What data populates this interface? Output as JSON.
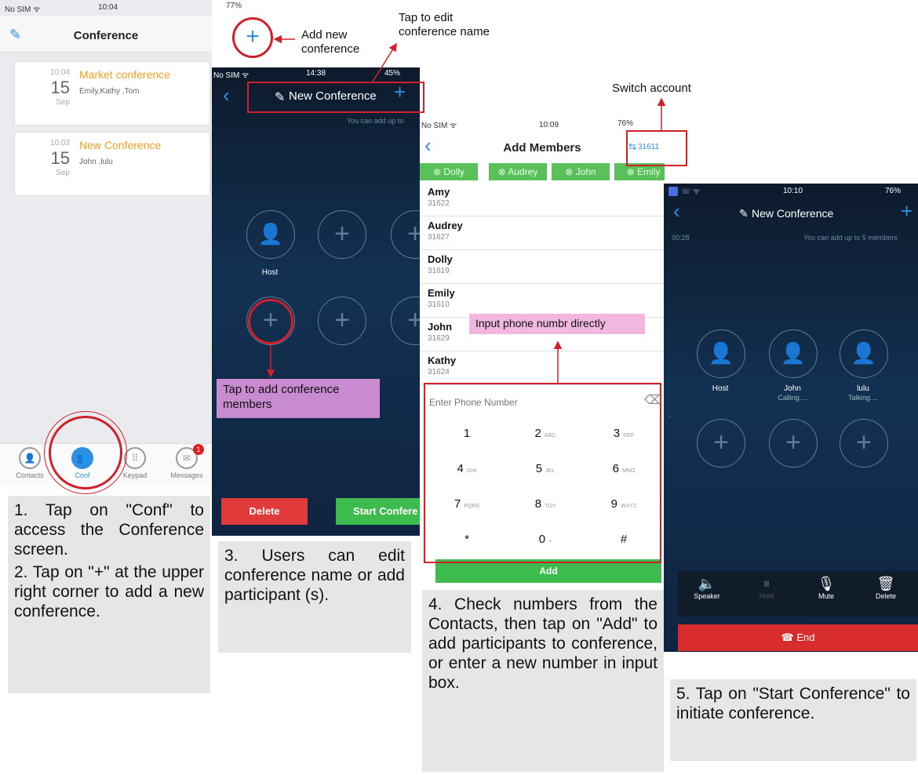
{
  "screen1": {
    "status": {
      "carrier": "No SIM ᯤ",
      "time": "10:04",
      "battery": "77%"
    },
    "title": "Conference",
    "conferences": [
      {
        "time": "10:04",
        "day": "15",
        "month": "Sep",
        "name": "Market conference",
        "participants": "Emily,Kathy ,Tom"
      },
      {
        "time": "10:03",
        "day": "15",
        "month": "Sep",
        "name": "New Conference",
        "participants": "John ,lulu"
      }
    ],
    "tabs": [
      {
        "label": "Contacts"
      },
      {
        "label": "Conf"
      },
      {
        "label": "Keypad"
      },
      {
        "label": "Messages"
      }
    ],
    "messages_badge": "1"
  },
  "screen3": {
    "status": {
      "carrier": "No SIM ᯤ",
      "time": "14:38",
      "battery": "45%"
    },
    "title": "New Conference",
    "hint": "You can add up to",
    "host_label": "Host",
    "delete_label": "Delete",
    "start_label": "Start Confere"
  },
  "screen4": {
    "status": {
      "carrier": "No SIM ᯤ",
      "time": "10:09",
      "battery": "76%"
    },
    "title": "Add Members",
    "account": "31611",
    "chips": [
      "⊗ Dolly",
      "⊗ Audrey",
      "⊗ John",
      "⊗ Emily"
    ],
    "contacts": [
      {
        "name": "Amy",
        "number": "31622"
      },
      {
        "name": "Audrey",
        "number": "31627"
      },
      {
        "name": "Dolly",
        "number": "31619"
      },
      {
        "name": "Emily",
        "number": "31610"
      },
      {
        "name": "John",
        "number": "31629"
      },
      {
        "name": "Kathy",
        "number": "31624"
      }
    ],
    "placeholder": "Enter Phone Number",
    "keys": [
      {
        "d": "1",
        "s": ""
      },
      {
        "d": "2",
        "s": "ABC"
      },
      {
        "d": "3",
        "s": "DEF"
      },
      {
        "d": "4",
        "s": "GHI"
      },
      {
        "d": "5",
        "s": "JKL"
      },
      {
        "d": "6",
        "s": "MNO"
      },
      {
        "d": "7",
        "s": "PQRS"
      },
      {
        "d": "8",
        "s": "TUV"
      },
      {
        "d": "9",
        "s": "WXYZ"
      },
      {
        "d": "*",
        "s": ""
      },
      {
        "d": "0",
        "s": "+"
      },
      {
        "d": "#",
        "s": ""
      }
    ],
    "add_label": "Add"
  },
  "screen5": {
    "status": {
      "time": "10:10",
      "battery": "76%"
    },
    "title": "New Conference",
    "duration": "00:28",
    "hint": "You can add up to 5 members",
    "members": [
      {
        "name": "Host",
        "state": ""
      },
      {
        "name": "John",
        "state": "Calling...."
      },
      {
        "name": "lulu",
        "state": "Talking...."
      }
    ],
    "controls": [
      {
        "label": "Speaker"
      },
      {
        "label": "Hold"
      },
      {
        "label": "Mute"
      },
      {
        "label": "Delete"
      }
    ],
    "end_label": "End"
  },
  "annotations": {
    "add_new": "Add new\nconference",
    "tap_edit": "Tap to edit\nconference name",
    "switch_account": "Switch account",
    "tap_add_members": "Tap to add conference\nmembers",
    "input_phone": "Input phone numbr directly"
  },
  "captions": {
    "c1a": "1. Tap on \"Conf\" to access the Conference screen.",
    "c1b": "2. Tap on \"+\" at the upper right corner to add a new conference.",
    "c3": "3. Users can edit conference name or add participant (s).",
    "c4": "4. Check numbers from the Contacts, then tap on \"Add\" to add participants to conference, or enter a new number in input box.",
    "c5": "5. Tap on \"Start Conference\" to initiate conference."
  },
  "colors": {
    "accent": "#2f8fe0",
    "annotation_red": "#d0202a",
    "green": "#3dbb4f",
    "orange": "#f0a020"
  }
}
